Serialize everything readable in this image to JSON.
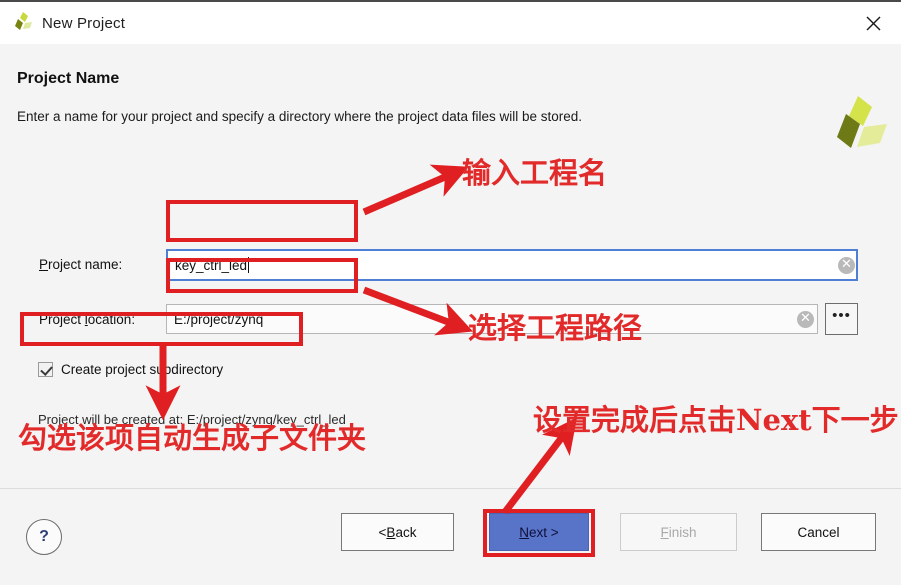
{
  "window": {
    "title": "New Project",
    "logo_icon": "xilinx-logo-icon",
    "close_icon": "close-icon"
  },
  "page": {
    "heading": "Project Name",
    "description": "Enter a name for your project and specify a directory where the project data files will be stored.",
    "brand_logo_icon": "xilinx-brand-logo-icon"
  },
  "form": {
    "project_name": {
      "label_prefix": "P",
      "label_rest": "roject name:",
      "value": "key_ctrl_led",
      "placeholder": "",
      "clear_icon": "clear-circle-icon",
      "focused": true
    },
    "project_location": {
      "label_a": "Project ",
      "label_mnemonic": "l",
      "label_b": "ocation:",
      "value": "E:/project/zynq",
      "placeholder": "",
      "clear_icon": "clear-circle-icon",
      "browse_label": "•••"
    },
    "create_subdirectory": {
      "label": "Create project subdirectory",
      "checked": true
    },
    "created_at_text": "Project will be created at: E:/project/zynq/key_ctrl_led"
  },
  "footer": {
    "help_label": "?",
    "buttons": [
      {
        "id": "back",
        "label_a": "< ",
        "mnemonic": "B",
        "label_b": "ack",
        "state": "enabled"
      },
      {
        "id": "next",
        "label_a": "",
        "mnemonic": "N",
        "label_b": "ext >",
        "state": "default"
      },
      {
        "id": "finish",
        "label_a": "",
        "mnemonic": "F",
        "label_b": "inish",
        "state": "disabled"
      },
      {
        "id": "cancel",
        "label_a": "",
        "mnemonic": "",
        "label_b": "Cancel",
        "state": "enabled"
      }
    ]
  },
  "annotations": {
    "color": "#e22a2a",
    "texts": [
      "输入工程名",
      "选择工程路径",
      "勾选该项自动生成子文件夹",
      "设置完成后点击Next下一步"
    ]
  },
  "colors": {
    "focus_border": "#4f7fd4",
    "default_button": "#5874c8",
    "annotation_red": "#e01f22",
    "logo_green_light": "#d4e34a",
    "logo_green_mid": "#e4ec9a",
    "logo_green_dark": "#6e7a16"
  }
}
